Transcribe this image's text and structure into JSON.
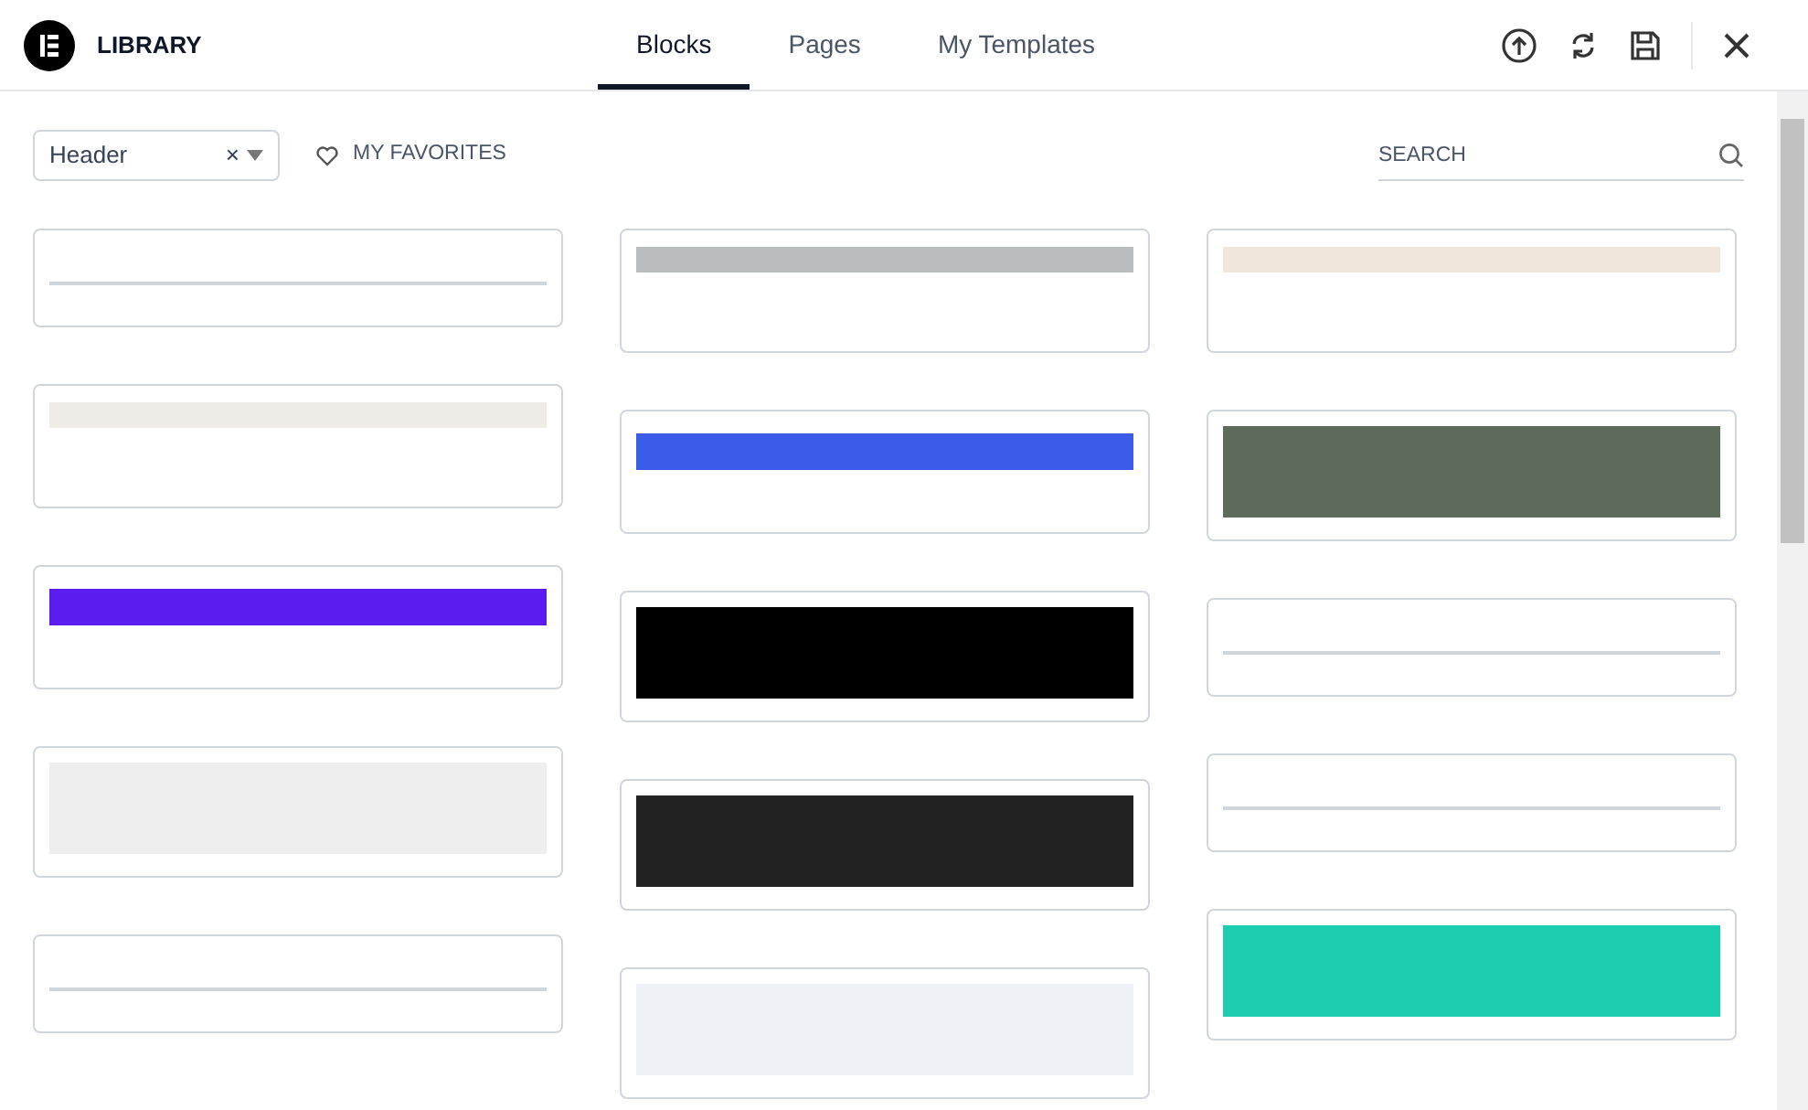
{
  "header": {
    "logo_text": "LIBRARY",
    "tabs": [
      {
        "label": "Blocks",
        "selected": true
      },
      {
        "label": "Pages",
        "selected": false
      },
      {
        "label": "My Templates",
        "selected": false
      }
    ]
  },
  "toolbar": {
    "category": {
      "value": "Header",
      "clear": "×"
    },
    "favorites": "MY FAVORITES",
    "search": {
      "placeholder": "SEARCH"
    }
  },
  "template_columns": [
    [
      {
        "kind": "plain",
        "color": "#ffffff"
      },
      {
        "kind": "strip",
        "color": "#efebe6"
      },
      {
        "kind": "bar",
        "color": "#5b1cf0"
      },
      {
        "kind": "block",
        "color": "#eeeeee"
      },
      {
        "kind": "plain",
        "color": "#ffffff"
      }
    ],
    [
      {
        "kind": "strip",
        "color": "#b9bdbd"
      },
      {
        "kind": "bar",
        "color": "#3b5ce8"
      },
      {
        "kind": "block",
        "color": "#000000"
      },
      {
        "kind": "block",
        "color": "#222222"
      },
      {
        "kind": "block",
        "color": "#eef1f5"
      }
    ],
    [
      {
        "kind": "strip",
        "color": "#f0e6dc"
      },
      {
        "kind": "block",
        "color": "#5e6b5a"
      },
      {
        "kind": "plain",
        "color": "#ffffff"
      },
      {
        "kind": "plain",
        "color": "#ffffff"
      },
      {
        "kind": "block",
        "color": "#1ccdb0"
      }
    ]
  ]
}
